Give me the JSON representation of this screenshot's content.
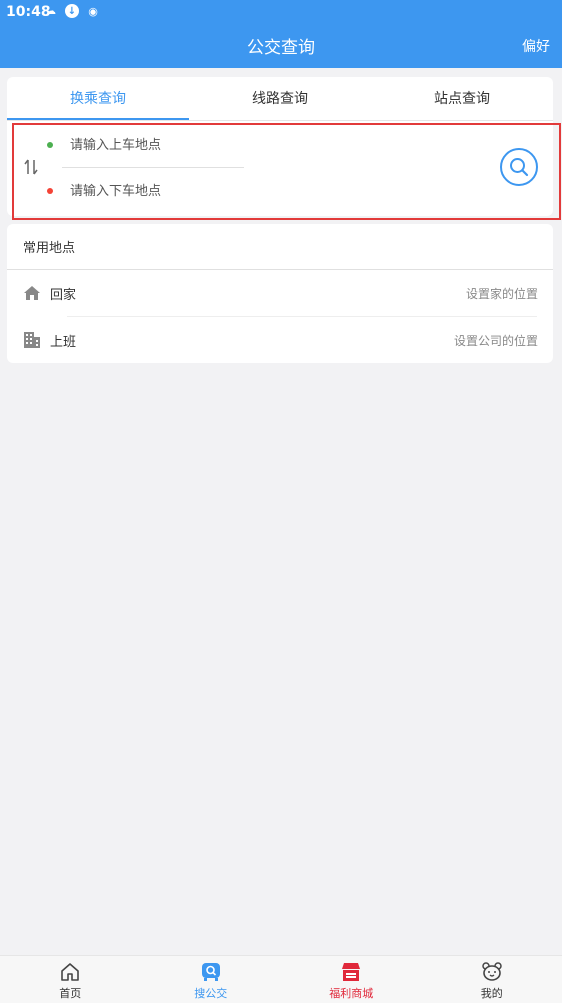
{
  "status": {
    "time": "10:48"
  },
  "header": {
    "title": "公交查询",
    "preferences": "偏好"
  },
  "tabs": [
    {
      "label": "换乘查询",
      "active": true
    },
    {
      "label": "线路查询",
      "active": false
    },
    {
      "label": "站点查询",
      "active": false
    }
  ],
  "transfer": {
    "from_placeholder": "请输入上车地点",
    "to_placeholder": "请输入下车地点"
  },
  "common_places": {
    "title": "常用地点",
    "items": [
      {
        "label": "回家",
        "action": "设置家的位置",
        "icon": "home-icon"
      },
      {
        "label": "上班",
        "action": "设置公司的位置",
        "icon": "building-icon"
      }
    ]
  },
  "bottom_nav": [
    {
      "label": "首页",
      "icon": "home-icon",
      "color": "#333333"
    },
    {
      "label": "搜公交",
      "icon": "bus-search-icon",
      "color": "#3d97f0"
    },
    {
      "label": "福利商城",
      "icon": "shop-icon",
      "color": "#e0283a"
    },
    {
      "label": "我的",
      "icon": "bear-face-icon",
      "color": "#333333"
    }
  ],
  "colors": {
    "primary": "#3d97f0",
    "highlight": "#e23a3a",
    "shop": "#e0283a"
  }
}
